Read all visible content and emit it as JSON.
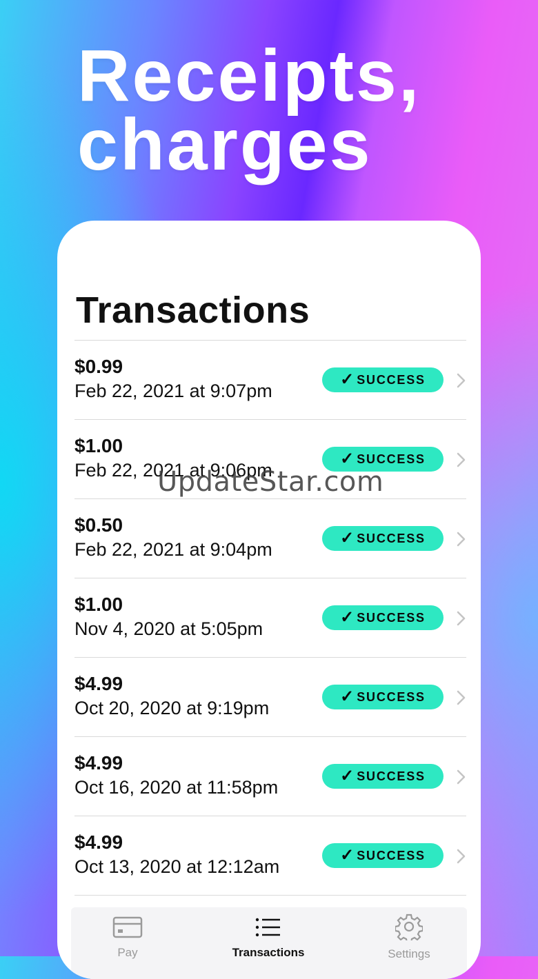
{
  "headline": {
    "line1": "Receipts,",
    "line2": "charges"
  },
  "screen": {
    "title": "Transactions",
    "transactions": [
      {
        "amount": "$0.99",
        "date": "Feb 22, 2021 at 9:07pm",
        "status": "SUCCESS"
      },
      {
        "amount": "$1.00",
        "date": "Feb 22, 2021 at 9:06pm",
        "status": "SUCCESS"
      },
      {
        "amount": "$0.50",
        "date": "Feb 22, 2021 at 9:04pm",
        "status": "SUCCESS"
      },
      {
        "amount": "$1.00",
        "date": "Nov 4, 2020 at 5:05pm",
        "status": "SUCCESS"
      },
      {
        "amount": "$4.99",
        "date": "Oct 20, 2020 at 9:19pm",
        "status": "SUCCESS"
      },
      {
        "amount": "$4.99",
        "date": "Oct 16, 2020 at 11:58pm",
        "status": "SUCCESS"
      },
      {
        "amount": "$4.99",
        "date": "Oct 13, 2020 at 12:12am",
        "status": "SUCCESS"
      }
    ],
    "badge_color": "#2ee8c2"
  },
  "tabbar": {
    "tabs": [
      {
        "label": "Pay",
        "icon": "credit-card-icon",
        "active": false
      },
      {
        "label": "Transactions",
        "icon": "list-icon",
        "active": true
      },
      {
        "label": "Settings",
        "icon": "gear-icon",
        "active": false
      }
    ]
  },
  "watermark": "UpdateStar.com"
}
